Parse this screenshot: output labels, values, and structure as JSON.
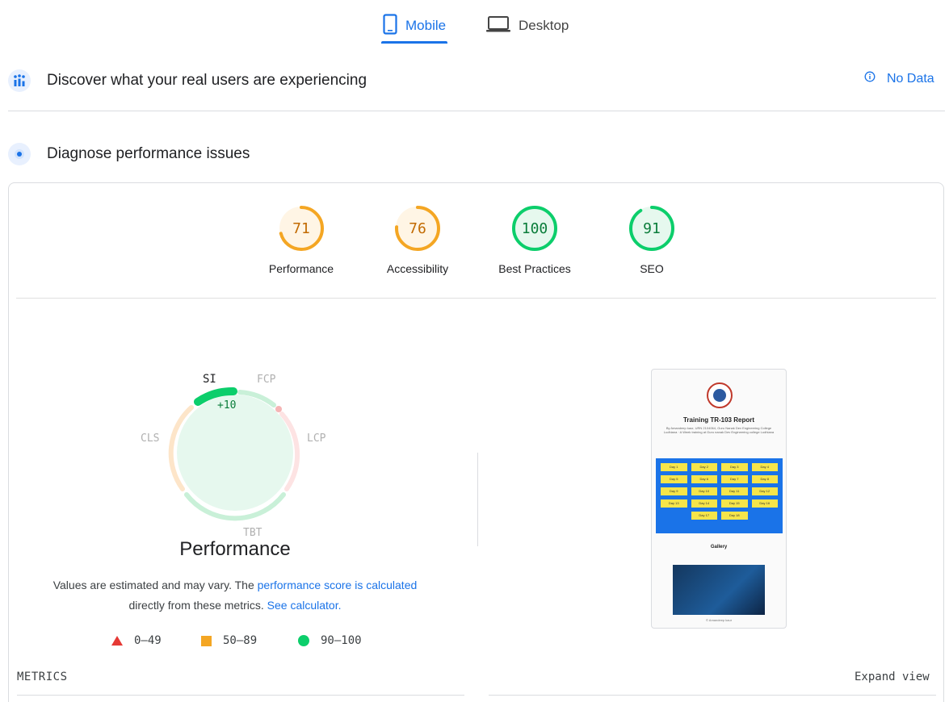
{
  "tabs": {
    "mobile_label": "Mobile",
    "desktop_label": "Desktop",
    "active": "mobile"
  },
  "discover": {
    "title": "Discover what your real users are experiencing",
    "status_label": "No Data"
  },
  "diagnose": {
    "title": "Diagnose performance issues"
  },
  "categories": [
    {
      "label": "Performance",
      "score": "71",
      "status": "average"
    },
    {
      "label": "Accessibility",
      "score": "76",
      "status": "average"
    },
    {
      "label": "Best Practices",
      "score": "100",
      "status": "pass"
    },
    {
      "label": "SEO",
      "score": "91",
      "status": "pass"
    }
  ],
  "performance": {
    "title": "Performance",
    "metric_labels": {
      "si": "SI",
      "fcp": "FCP",
      "lcp": "LCP",
      "tbt": "TBT",
      "cls": "CLS"
    },
    "si_delta": "+10",
    "desc_prefix": "Values are estimated and may vary. The ",
    "desc_link1": "performance score is calculated",
    "desc_middle": " directly from these metrics. ",
    "desc_link2": "See calculator."
  },
  "legend": [
    {
      "range": "0–49",
      "shape": "triangle",
      "color": "#e53935"
    },
    {
      "range": "50–89",
      "shape": "square",
      "color": "#f4a623"
    },
    {
      "range": "90–100",
      "shape": "circle",
      "color": "#0cce6b"
    }
  ],
  "thumbnail": {
    "title": "Training TR-103 Report",
    "subtitle": "By Amandeep kaur, URN 2104064, Guru Nanak Dev Engineering College Ludhiana · A Week training at Guru nanak Dev Engineering college Ludhiana",
    "days": [
      "Day 1",
      "Day 2",
      "Day 3",
      "Day 4",
      "Day 5",
      "Day 6",
      "Day 7",
      "Day 8",
      "Day 9",
      "Day 10",
      "Day 11",
      "Day 12",
      "Day 13",
      "Day 14",
      "Day 15",
      "Day 16",
      "Day 17",
      "Day 18"
    ],
    "gallery_label": "Gallery",
    "footer": "© Amandeep kaur"
  },
  "metrics_heading": "METRICS",
  "expand_view_label": "Expand view",
  "colors": {
    "accent": "#1a73e8",
    "average": "#f4a623",
    "pass": "#0cce6b",
    "fail": "#e53935"
  }
}
